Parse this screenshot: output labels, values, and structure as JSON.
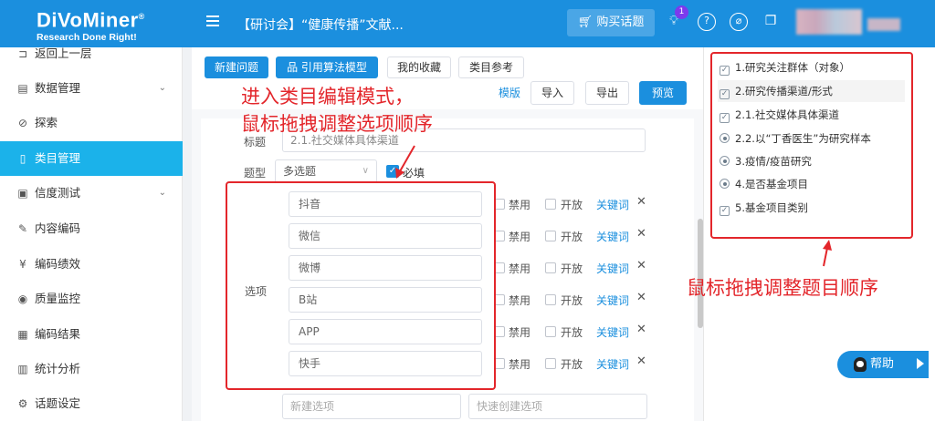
{
  "app": {
    "logo_brand": "DiVoMiner",
    "logo_reg": "®",
    "logo_tagline": "Research Done Right!",
    "project_title": "【研讨会】“健康传播”文献...",
    "buy_label": "购买话题",
    "notification_count": "1"
  },
  "sidebar": {
    "items": [
      {
        "label": "返回上一层",
        "icon": "back-icon"
      },
      {
        "label": "数据管理",
        "icon": "document-icon"
      },
      {
        "label": "探索",
        "icon": "compass-icon"
      },
      {
        "label": "类目管理",
        "icon": "file-icon"
      },
      {
        "label": "信度测试",
        "icon": "clipboard-icon"
      },
      {
        "label": "内容编码",
        "icon": "pen-icon"
      },
      {
        "label": "编码绩效",
        "icon": "currency-icon"
      },
      {
        "label": "质量监控",
        "icon": "eye-icon"
      },
      {
        "label": "编码结果",
        "icon": "report-icon"
      },
      {
        "label": "统计分析",
        "icon": "bar-chart-icon"
      },
      {
        "label": "话题设定",
        "icon": "gear-icon"
      }
    ]
  },
  "toolbar": {
    "new_question": "新建问题",
    "algorithm_model": "引用算法模型",
    "favorites": "我的收藏",
    "category_reference": "类目参考",
    "template_link": "模版",
    "import": "导入",
    "export": "导出",
    "preview": "预览"
  },
  "form": {
    "title_label": "标题",
    "title_value": "2.1.社交媒体具体渠道",
    "type_label": "题型",
    "type_value": "多选题",
    "required_label": "必填",
    "options_label": "选项",
    "options": [
      {
        "value": "抖音",
        "disable": "禁用",
        "open": "开放",
        "keyword": "关键词"
      },
      {
        "value": "微信",
        "disable": "禁用",
        "open": "开放",
        "keyword": "关键词"
      },
      {
        "value": "微博",
        "disable": "禁用",
        "open": "开放",
        "keyword": "关键词"
      },
      {
        "value": "B站",
        "disable": "禁用",
        "open": "开放",
        "keyword": "关键词"
      },
      {
        "value": "APP",
        "disable": "禁用",
        "open": "开放",
        "keyword": "关键词"
      },
      {
        "value": "快手",
        "disable": "禁用",
        "open": "开放",
        "keyword": "关键词"
      }
    ],
    "new_option_placeholder": "新建选项",
    "quick_create_placeholder": "快速创建选项"
  },
  "questions": [
    {
      "label": "1.研究关注群体（对象）",
      "kind": "checkbox"
    },
    {
      "label": "2.研究传播渠道/形式",
      "kind": "checkbox"
    },
    {
      "label": "2.1.社交媒体具体渠道",
      "kind": "checkbox"
    },
    {
      "label": "2.2.以“丁香医生”为研究样本",
      "kind": "radio"
    },
    {
      "label": "3.疫情/疫苗研究",
      "kind": "radio"
    },
    {
      "label": "4.是否基金项目",
      "kind": "radio"
    },
    {
      "label": "5.基金项目类别",
      "kind": "checkbox"
    }
  ],
  "annotations": {
    "edit_mode_line1": "进入类目编辑模式，",
    "edit_mode_line2": "鼠标拖拽调整选项顺序",
    "reorder_questions": "鼠标拖拽调整题目顺序"
  },
  "help": {
    "label": "帮助"
  },
  "colors": {
    "brand_blue": "#1b8fde",
    "sidebar_active": "#1bb2ea",
    "annotation_red": "#e3262b"
  }
}
